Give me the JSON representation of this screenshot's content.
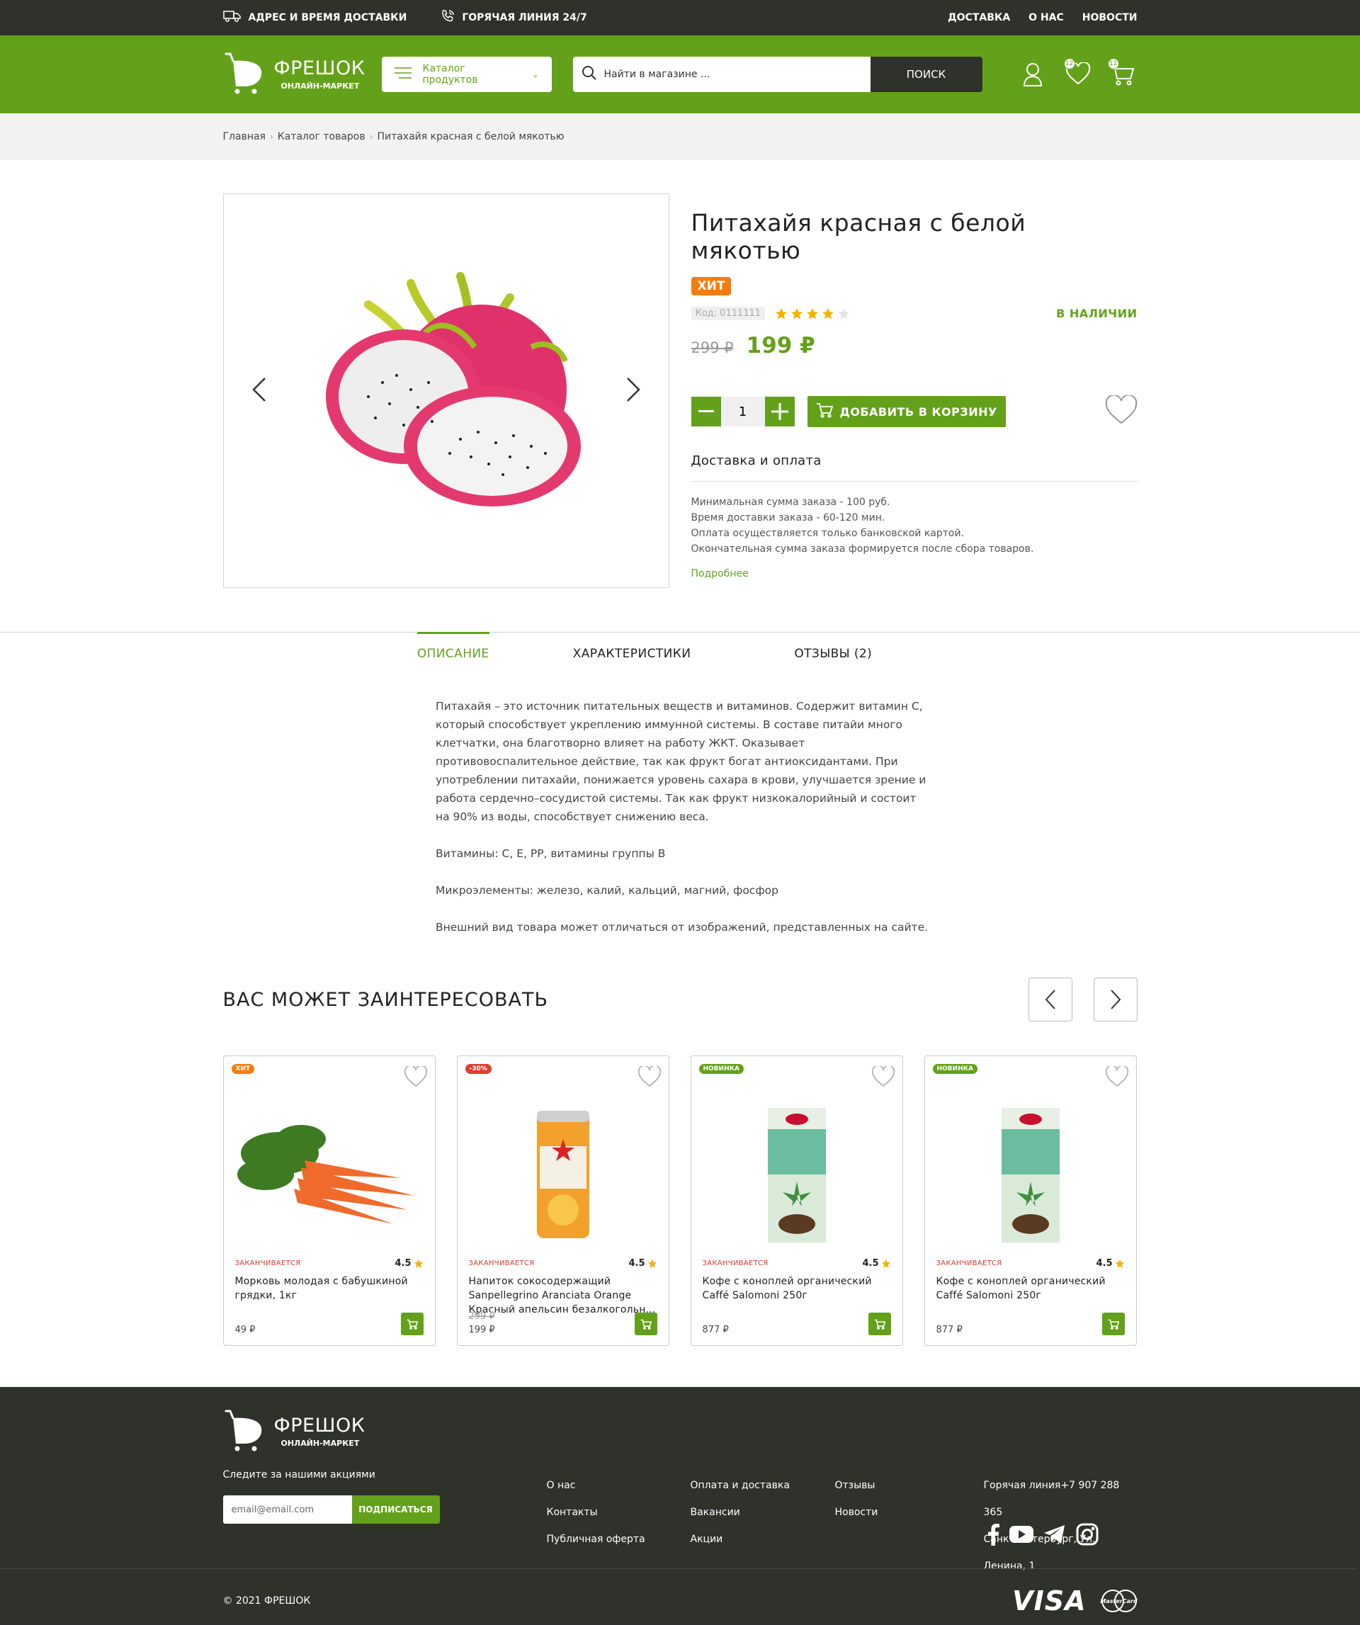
{
  "topbar": {
    "delivery_info": "АДРЕС И ВРЕМЯ ДОСТАВКИ",
    "hotline": "ГОРЯЧАЯ ЛИНИЯ 24/7",
    "links": [
      "ДОСТАВКА",
      "О НАС",
      "НОВОСТИ"
    ]
  },
  "header": {
    "logo_name": "ФРЕШОК",
    "logo_sub": "ОНЛАЙН-МАРКЕТ",
    "catalog_label": "Каталог продуктов",
    "search_placeholder": "Найти в магазине ...",
    "search_button": "ПОИСК",
    "favorites_count": "12",
    "cart_count": "12"
  },
  "breadcrumbs": [
    "Главная",
    "Каталог товаров",
    "Питахайя красная с белой мякотью"
  ],
  "product": {
    "title": "Питахайя красная с белой мякотью",
    "badge": "ХИТ",
    "code": "Код: 0111111",
    "rating": 4,
    "stock": "В НАЛИЧИИ",
    "old_price": "299 ₽",
    "price": "199 ₽",
    "quantity": "1",
    "add_to_cart": "ДОБАВИТЬ В КОРЗИНУ",
    "delivery_title": "Доставка и оплата",
    "delivery_lines": [
      "Минимальная сумма заказа - 100 руб.",
      "Время доставки заказа - 60-120 мин.",
      "Оплата осуществляется только банковской картой.",
      "Окончательная сумма заказа формируется после сбора товаров."
    ],
    "more_link": "Подробнее"
  },
  "tabs": {
    "description": "ОПИСАНИЕ",
    "specs": "ХАРАКТЕРИСТИКИ",
    "reviews": "ОТЗЫВЫ (2)"
  },
  "description": [
    "Питахайя – это источник питательных веществ и витаминов. Содержит витамин С, который способствует укреплению иммунной системы. В составе питайи много клетчатки, она благотворно влияет на работу ЖКТ. Оказывает противовоспалительное действие, так как фрукт богат антиоксидантами. При употреблении питахайи, понижается уровень сахара в крови, улучшается зрение и работа сердечно–сосудистой системы. Так как фрукт низкокалорийный и состоит на 90% из воды, способствует снижению веса.",
    "Витамины: С, Е, РР, витамины группы В",
    "Микроэлементы: железо, калий, кальций, магний, фосфор",
    "Внешний вид товара может отличаться от изображений, представленных на сайте."
  ],
  "related": {
    "title": "ВАС МОЖЕТ ЗАИНТЕРЕСОВАТЬ",
    "cards": [
      {
        "tag": "ХИТ",
        "status": "ЗАКАНЧИВАЕТСЯ",
        "rating": "4.5",
        "name": "Морковь молодая с бабушкиной грядки, 1кг",
        "old_price": "",
        "price": "49 ₽"
      },
      {
        "tag": "-30%",
        "status": "ЗАКАНЧИВАЕТСЯ",
        "rating": "4.5",
        "name": "Напиток сокосодержащий Sanpellegrino Aranciata Orange Красный апельсин безалкогольн...",
        "old_price": "299 ₽",
        "price": "199 ₽"
      },
      {
        "tag": "НОВИНКА",
        "status": "ЗАКАНЧИВАЕТСЯ",
        "rating": "4.5",
        "name": "Кофе с коноплей органический Caffé Salomoni 250г",
        "old_price": "",
        "price": "877 ₽"
      },
      {
        "tag": "НОВИНКА",
        "status": "ЗАКАНЧИВАЕТСЯ",
        "rating": "4.5",
        "name": "Кофе с коноплей органический Caffé Salomoni 250г",
        "old_price": "",
        "price": "877 ₽"
      }
    ]
  },
  "footer": {
    "logo_name": "ФРЕШОК",
    "logo_sub": "ОНЛАЙН-МАРКЕТ",
    "follow": "Следите за нашими акциями",
    "email_placeholder": "email@email.com",
    "subscribe": "ПОДПИСАТЬСЯ",
    "col1": [
      "О нас",
      "Контакты",
      "Публичная оферта"
    ],
    "col2": [
      "Оплата и доставка",
      "Вакансии",
      "Акции"
    ],
    "col3": [
      "Отзывы",
      "Новости"
    ],
    "hotline": "Горячая линия+7 907 288 365",
    "address": "Санкт-Петербург, Ул. Ленина, 1",
    "copyright": "© 2021 ФРЕШОК",
    "visa": "VISA",
    "mastercard": "MasterCard"
  },
  "colors": {
    "brand_green": "#64a11a",
    "dark": "#2f312b",
    "hit_orange": "#f47d0e",
    "sale_red": "#e03c31"
  }
}
